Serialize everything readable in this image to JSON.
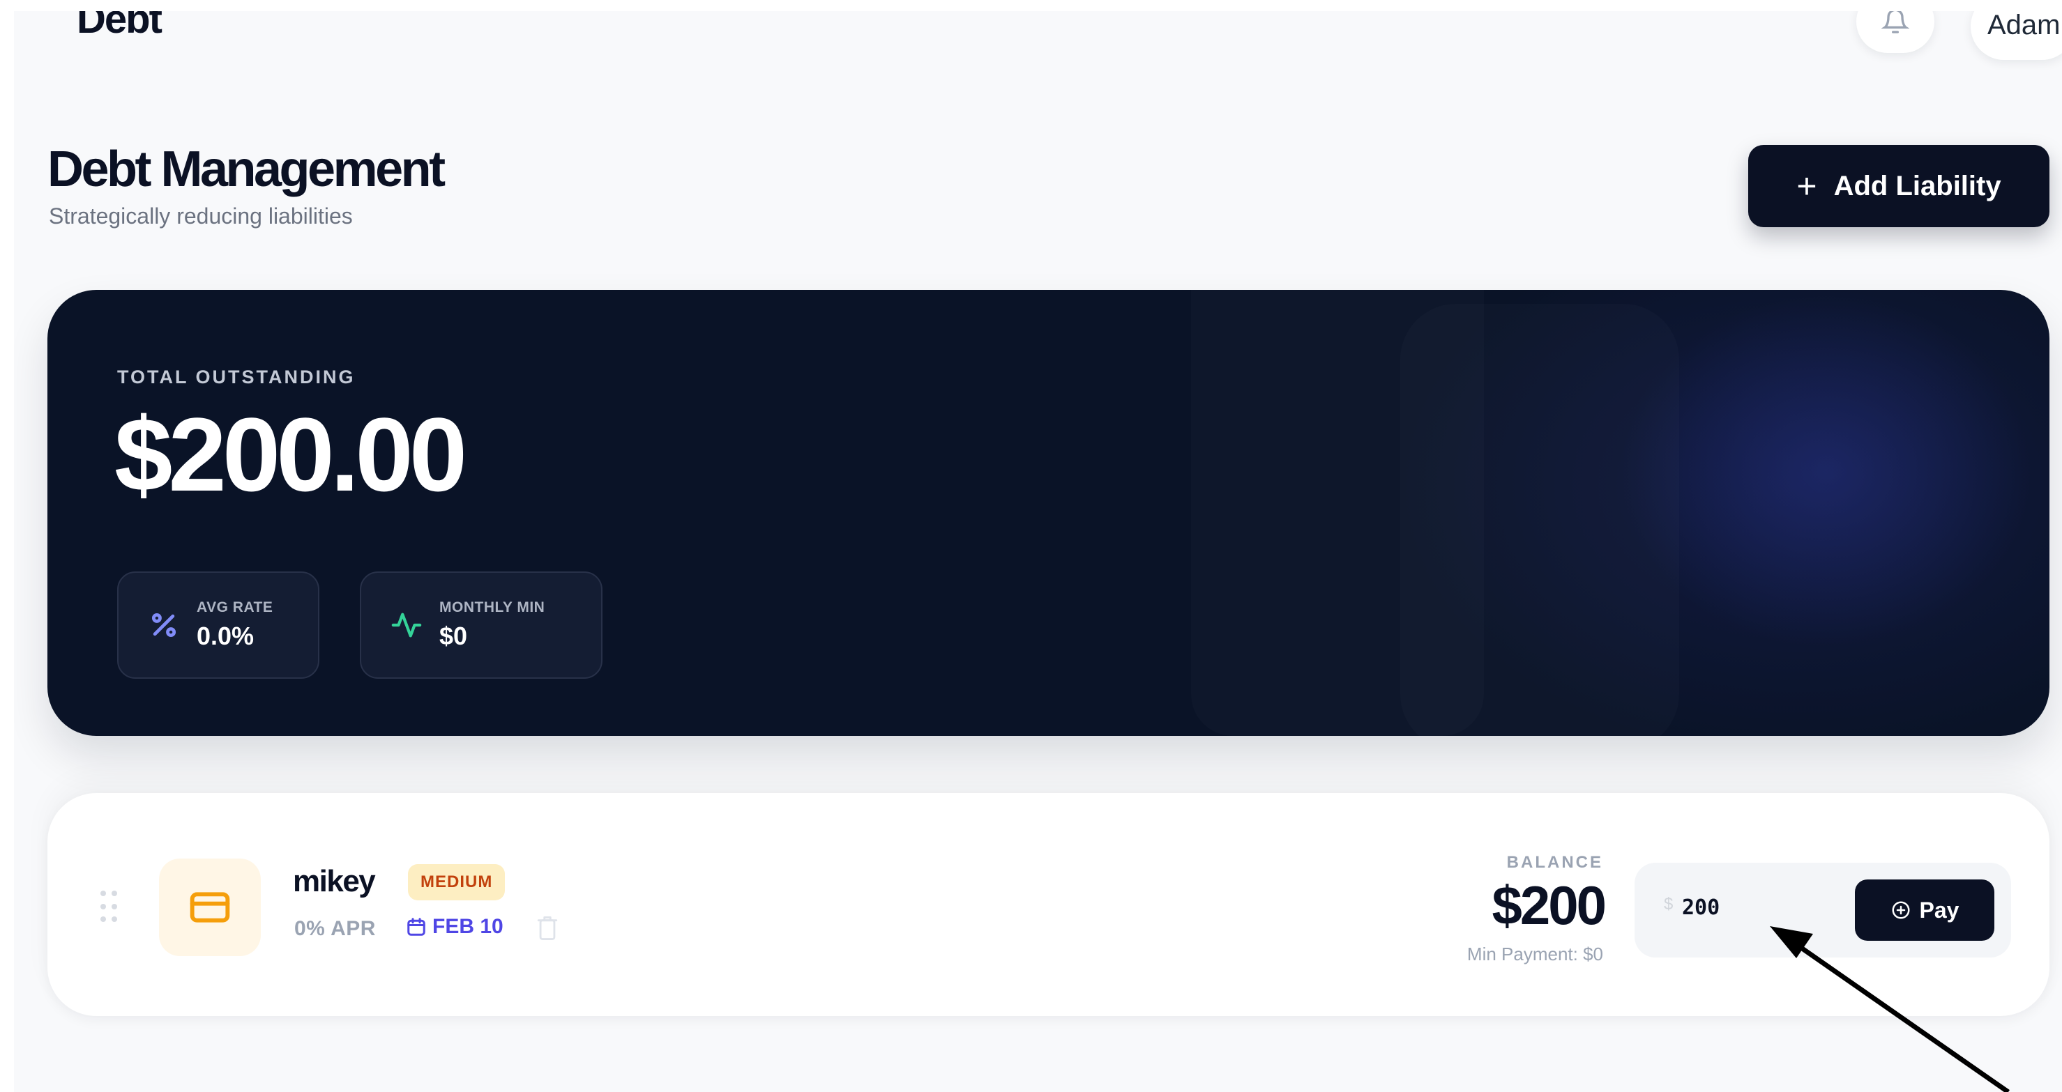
{
  "topbar": {
    "title": "Debt",
    "user_name": "Adam"
  },
  "header": {
    "title": "Debt Management",
    "subtitle": "Strategically reducing liabilities",
    "add_button_label": "Add Liability"
  },
  "summary": {
    "label": "TOTAL OUTSTANDING",
    "amount": "$200.00",
    "stats": {
      "avg_rate_label": "AVG RATE",
      "avg_rate_value": "0.0%",
      "monthly_min_label": "MONTHLY MIN",
      "monthly_min_value": "$0"
    }
  },
  "liabilities": [
    {
      "name": "mikey",
      "priority": "MEDIUM",
      "apr": "0% APR",
      "due_date": "FEB 10",
      "balance_label": "BALANCE",
      "balance": "$200",
      "min_payment": "Min Payment: $0",
      "currency_symbol": "$",
      "payment_value": "200",
      "pay_button_label": "Pay"
    }
  ],
  "colors": {
    "navy": "#0b1124",
    "hero_bg": "#0a1327",
    "accent_indigo": "#4f46e5",
    "accent_green": "#34d399",
    "badge_bg": "#fdeec2",
    "badge_text": "#c2410c",
    "icon_orange": "#f59e0b"
  },
  "icons": {
    "bell": "bell-icon",
    "plus": "plus-icon",
    "percent": "percent-icon",
    "pulse": "activity-icon",
    "card": "credit-card-icon",
    "calendar": "calendar-icon",
    "trash": "trash-icon",
    "drag": "drag-handle-icon",
    "pay": "plus-circle-icon"
  }
}
